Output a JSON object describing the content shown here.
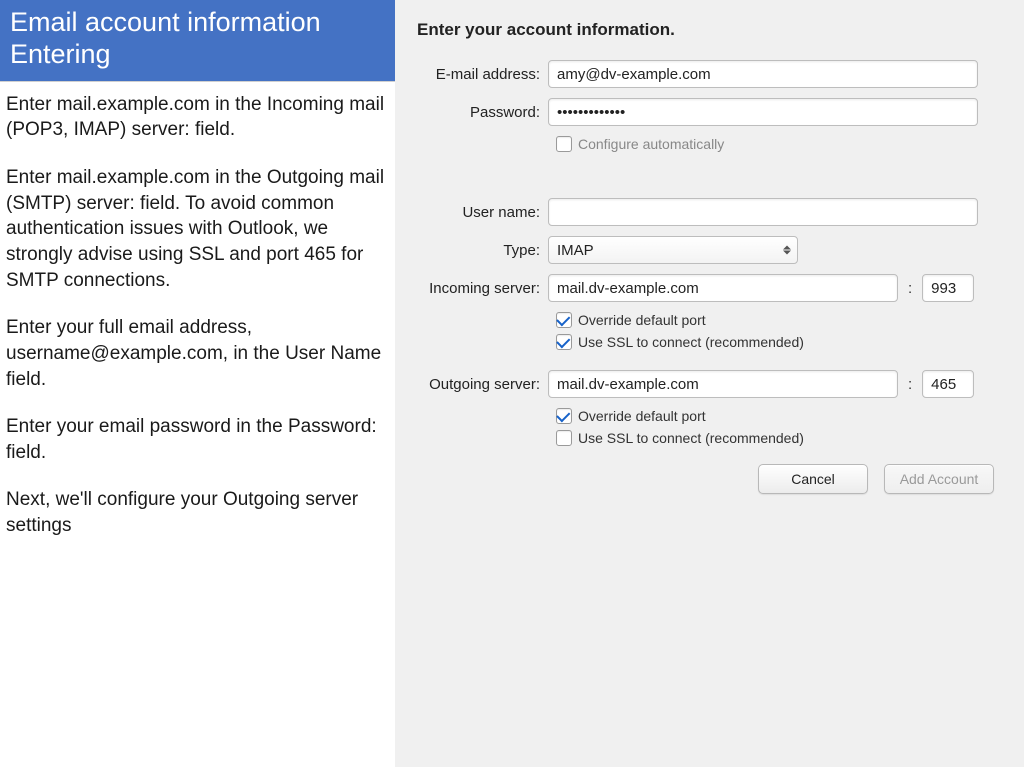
{
  "left": {
    "title": "Email account information Entering",
    "p1": "Enter mail.example.com in the Incoming mail (POP3, IMAP) server: field.",
    "p2": "Enter mail.example.com in the Outgoing mail (SMTP) server: field. To avoid common authentication issues with Outlook, we strongly advise using SSL and port 465 for SMTP connections.",
    "p3": "Enter your full email address, username@example.com, in the User Name field.",
    "p4": "Enter your email password in the Password: field.",
    "p5": "Next, we'll configure your Outgoing server settings"
  },
  "dialog": {
    "heading": "Enter your account information.",
    "labels": {
      "email": "E-mail address:",
      "password": "Password:",
      "username": "User name:",
      "type": "Type:",
      "incoming": "Incoming server:",
      "outgoing": "Outgoing server:"
    },
    "values": {
      "email": "amy@dv-example.com",
      "password": "•••••••••••••",
      "username": "",
      "type": "IMAP",
      "incoming_server": "mail.dv-example.com",
      "incoming_port": "993",
      "outgoing_server": "mail.dv-example.com",
      "outgoing_port": "465"
    },
    "checkboxes": {
      "configure_auto": "Configure automatically",
      "override_port": "Override default port",
      "use_ssl": "Use SSL to connect (recommended)"
    },
    "buttons": {
      "cancel": "Cancel",
      "add": "Add Account"
    },
    "port_sep": ":"
  }
}
